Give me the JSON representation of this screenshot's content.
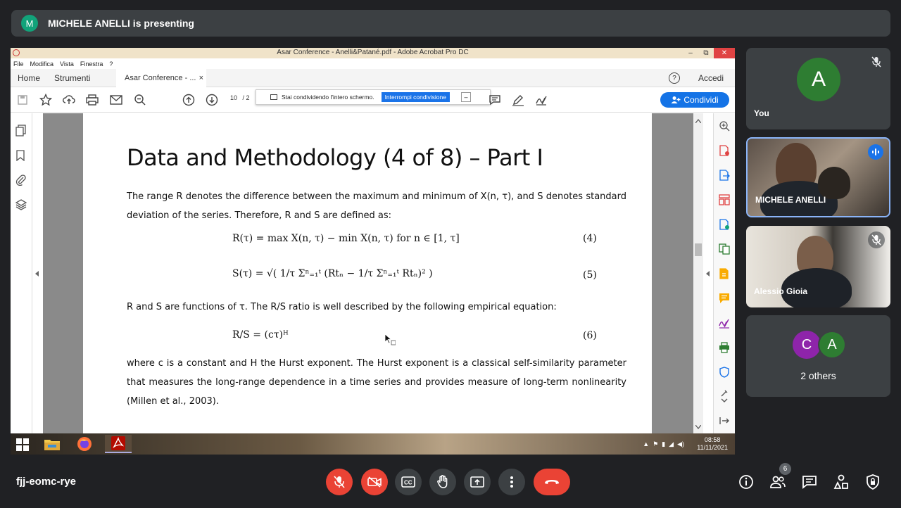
{
  "banner": {
    "avatar_letter": "M",
    "text": "MICHELE ANELLI is presenting"
  },
  "acrobat": {
    "window_title": "Asar Conference - Anelli&Patané.pdf - Adobe Acrobat Pro DC",
    "window_buttons": {
      "minimize": "–",
      "restore": "⧉",
      "close": "✕"
    },
    "menu": [
      "File",
      "Modifica",
      "Vista",
      "Finestra",
      "?"
    ],
    "tabs": {
      "home": "Home",
      "tools": "Strumenti",
      "document": "Asar Conference - ...",
      "close": "×"
    },
    "help": "?",
    "signin": "Accedi",
    "page_number": "10",
    "page_sep": "/ 2",
    "share_popup": {
      "text": "Stai condividendo l'intero schermo.",
      "stop": "Interrompi condivisione",
      "minimize": "–"
    },
    "share_button": "Condividi"
  },
  "slide": {
    "title": "Data and Methodology (4 of 8) – Part I",
    "para1": "The range R denotes the difference between the maximum and minimum of X(n, τ), and S denotes standard deviation of the series. Therefore, R and S are defined as:",
    "eq4": "R(τ) = max X(n, τ) − min X(n, τ)  for n ∈ [1, τ]",
    "eq4_num": "(4)",
    "eq5": "S(τ) = √( 1/τ Σⁿ₌₁ᵗ (Rtₙ − 1/τ Σⁿ₌₁ᵗ Rtₙ)² )",
    "eq5_num": "(5)",
    "para2": "R and S are functions of τ.  The R/S ratio is well described by the following empirical equation:",
    "eq6": "R/S = (cτ)ᴴ",
    "eq6_num": "(6)",
    "para3": "where c is a constant and H the Hurst exponent. The Hurst exponent is a classical self-similarity parameter that measures the long-range dependence in a time series and provides measure of long-term nonlinearity (Millen et al., 2003)."
  },
  "taskbar": {
    "time": "08:58",
    "date": "11/11/2021"
  },
  "participants": {
    "you": {
      "letter": "A",
      "name": "You"
    },
    "presenter": {
      "name": "MICHELE ANELLI"
    },
    "third": {
      "name": "Alessio Gioia"
    },
    "others": {
      "letters": [
        "C",
        "A"
      ],
      "label": "2 others"
    }
  },
  "colors": {
    "avatar_you": "#2e7d32",
    "avatar_c": "#8e24aa",
    "avatar_a": "#2e7d32",
    "hangup": "#ea4335",
    "accent": "#1a73e8"
  },
  "meeting": {
    "code": "fjj-eomc-rye",
    "people_count": "6"
  }
}
